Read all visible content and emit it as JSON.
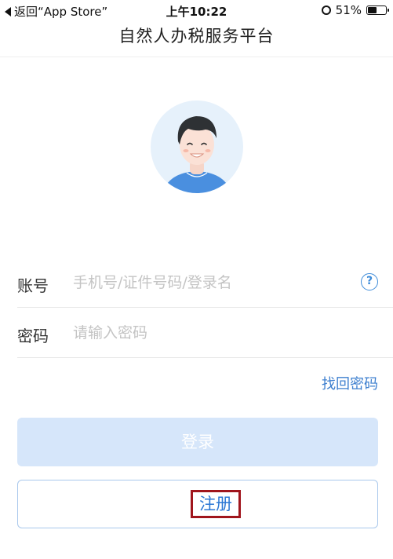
{
  "status_bar": {
    "back_label": "返回“App Store”",
    "time": "上午10:22",
    "battery_text": "51%",
    "battery_level": 0.51
  },
  "nav": {
    "title": "自然人办税服务平台"
  },
  "avatar": {
    "icon": "user-avatar-icon"
  },
  "form": {
    "account_label": "账号",
    "account_placeholder": "手机号/证件号码/登录名",
    "password_label": "密码",
    "password_placeholder": "请输入密码",
    "help_symbol": "?"
  },
  "links": {
    "forgot_password": "找回密码"
  },
  "buttons": {
    "login": "登录",
    "register": "注册"
  },
  "colors": {
    "accent": "#3d8bd9",
    "login_disabled_bg": "#d6e6fa",
    "highlight_box": "#a0151c"
  }
}
